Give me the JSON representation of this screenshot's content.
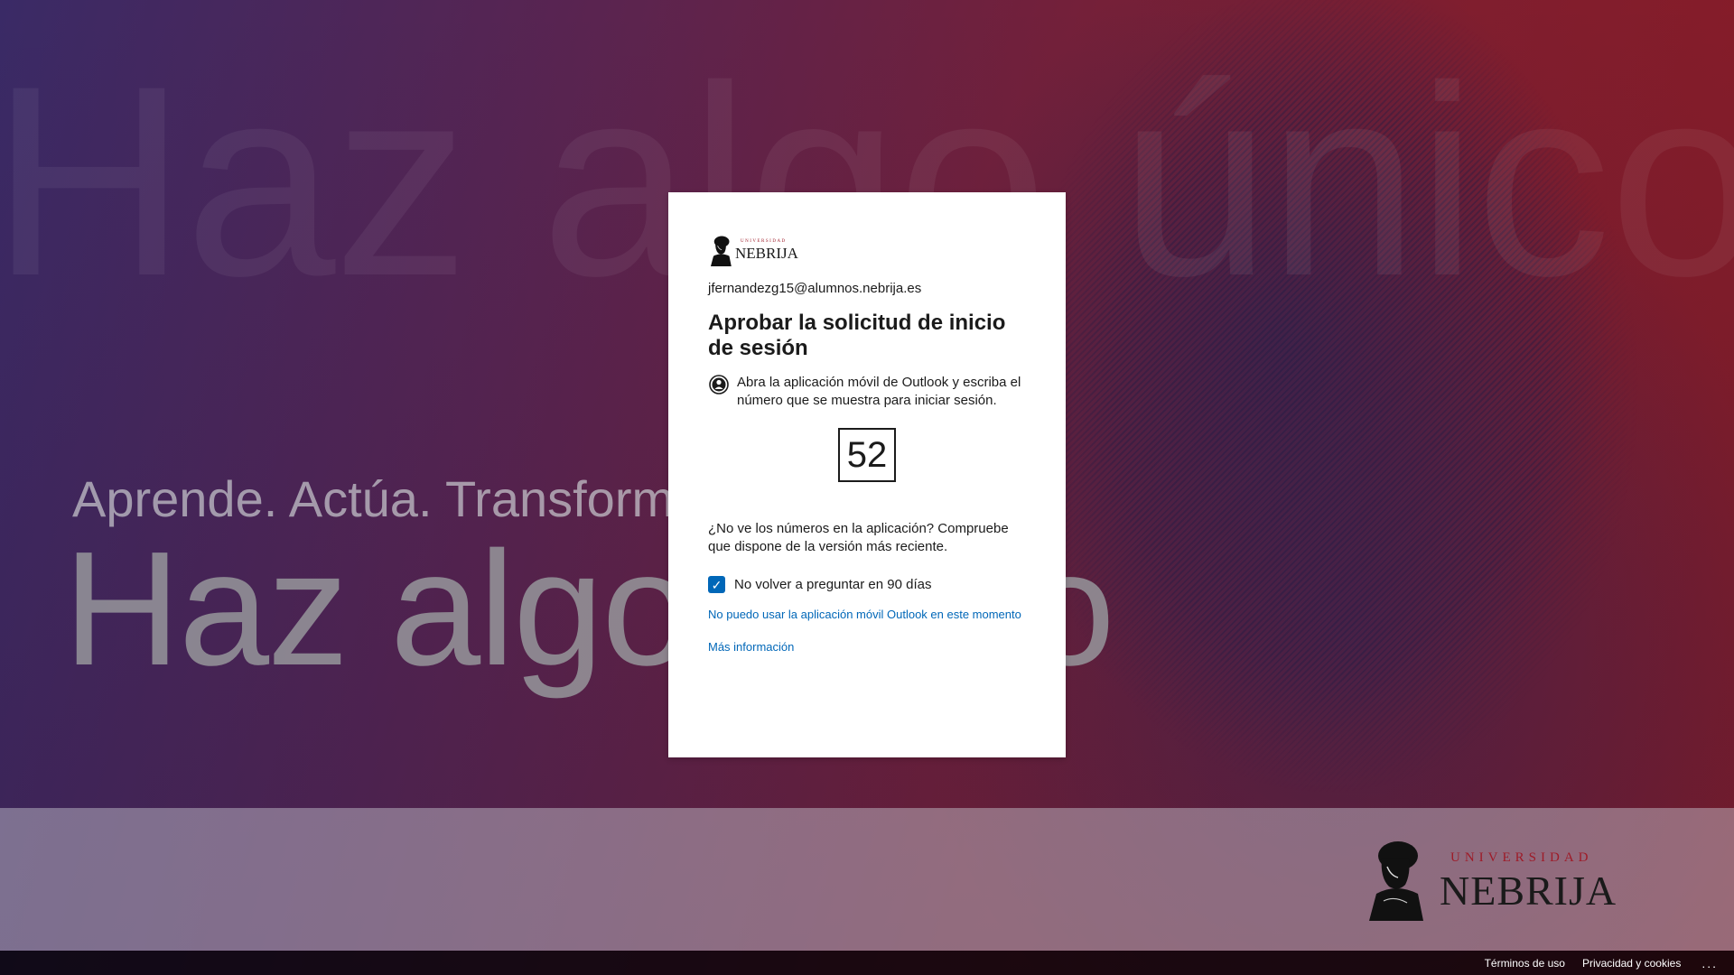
{
  "background": {
    "ghost_headline": "Haz algo único",
    "tagline": "Aprende. Actúa. Transforma",
    "headline": "Haz algo único"
  },
  "brand": {
    "university_label": "UNIVERSIDAD",
    "name": "NEBRIJA"
  },
  "card": {
    "logo_university": "UNIVERSIDAD",
    "logo_name": "NEBRIJA",
    "identity": "jfernandezg15@alumnos.nebrija.es",
    "title": "Aprobar la solicitud de inicio de sesión",
    "instruction": "Abra la aplicación móvil de Outlook y escriba el número que se muestra para iniciar sesión.",
    "number": "52",
    "help_text": "¿No ve los números en la aplicación? Compruebe que dispone de la versión más reciente.",
    "checkbox_label": "No volver a preguntar en 90 días",
    "checkbox_checked": true,
    "checkbox_mark": "✓",
    "link_cant_use": "No puedo usar la aplicación móvil Outlook en este momento",
    "link_more_info": "Más información"
  },
  "footer": {
    "terms": "Términos de uso",
    "privacy": "Privacidad y cookies",
    "more": "..."
  },
  "colors": {
    "accent": "#0067b8",
    "brand_red": "#9e1b28"
  }
}
